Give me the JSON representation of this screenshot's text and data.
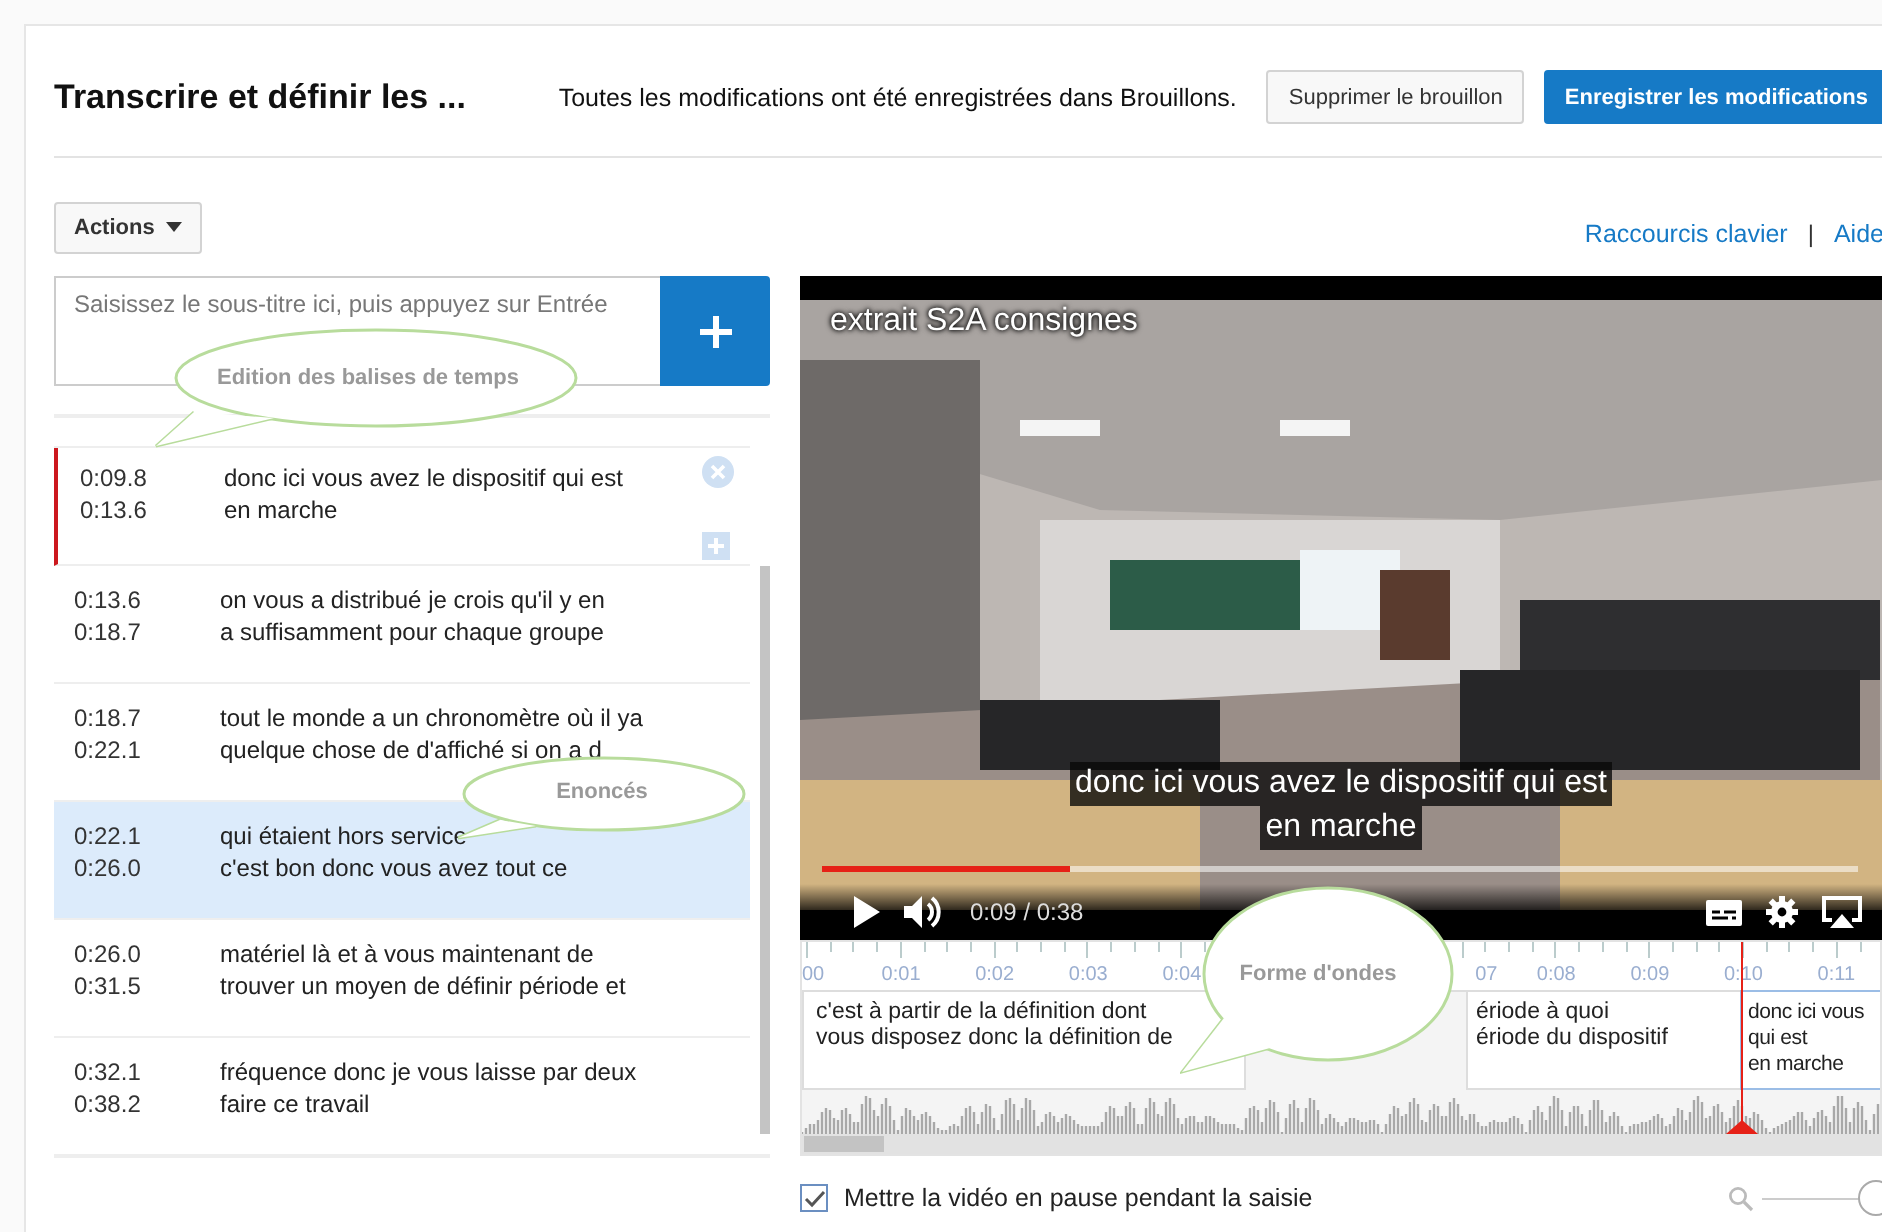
{
  "header": {
    "title": "Transcrire et définir les ...",
    "status": "Toutes les modifications ont été enregistrées dans Brouillons.",
    "buttons": [
      {
        "label": "Supprimer le brouillon",
        "kind": "secondary"
      },
      {
        "label": "Enregistrer les modifications",
        "kind": "primary"
      }
    ]
  },
  "toolbar": {
    "actions_menu": "Actions",
    "links": [
      "Raccourcis clavier",
      "Aide"
    ],
    "separator": "|"
  },
  "caption_input": {
    "placeholder": "Saisissez le sous-titre ici, puis appuyez sur Entrée"
  },
  "captions": [
    {
      "start": "0:09.8",
      "end": "0:13.6",
      "lines": [
        "donc ici vous avez le dispositif qui est",
        "en marche"
      ],
      "editing": true,
      "selected": false
    },
    {
      "start": "0:13.6",
      "end": "0:18.7",
      "lines": [
        "on vous a distribué je crois qu'il y en",
        "a suffisamment pour chaque groupe"
      ],
      "editing": false,
      "selected": false
    },
    {
      "start": "0:18.7",
      "end": "0:22.1",
      "lines": [
        "tout le monde a un chronomètre où il ya",
        "quelque chose de d'affiché si on a d"
      ],
      "editing": false,
      "selected": false
    },
    {
      "start": "0:22.1",
      "end": "0:26.0",
      "lines": [
        "qui étaient hors service",
        "c'est bon donc vous avez tout ce"
      ],
      "editing": false,
      "selected": true
    },
    {
      "start": "0:26.0",
      "end": "0:31.5",
      "lines": [
        "matériel là et à vous maintenant de",
        "trouver un moyen de définir période et"
      ],
      "editing": false,
      "selected": false
    },
    {
      "start": "0:32.1",
      "end": "0:38.2",
      "lines": [
        "fréquence donc je vous laisse par deux",
        "faire ce travail"
      ],
      "editing": false,
      "selected": false
    }
  ],
  "video": {
    "title": "extrait S2A consignes",
    "subtitle": [
      "donc ici vous avez le dispositif qui est",
      "en marche"
    ],
    "progress": {
      "level": 0.24
    },
    "time": "0:09 / 0:38"
  },
  "timeline": {
    "ticks": [
      "00",
      "0:01",
      "0:02",
      "0:03",
      "0:04",
      "07",
      "0:08",
      "0:09",
      "0:10",
      "0:11"
    ],
    "segments": [
      {
        "lines": [
          "c'est à partir de la définition dont",
          "vous disposez donc la définition de"
        ],
        "selected": false
      },
      {
        "lines": [
          "ériode à quoi",
          "ériode du dispositif"
        ],
        "selected": false
      },
      {
        "lines": [
          "donc ici vous",
          "qui est",
          "en marche"
        ],
        "selected": true
      }
    ]
  },
  "pause_option": {
    "label": "Mettre la vidéo en pause pendant la saisie",
    "checked": true
  },
  "zoom": {
    "level": 1
  },
  "callouts": [
    {
      "label": "Edition des balises de temps"
    },
    {
      "label": "Enoncés"
    },
    {
      "label": "Forme d'ondes"
    }
  ]
}
